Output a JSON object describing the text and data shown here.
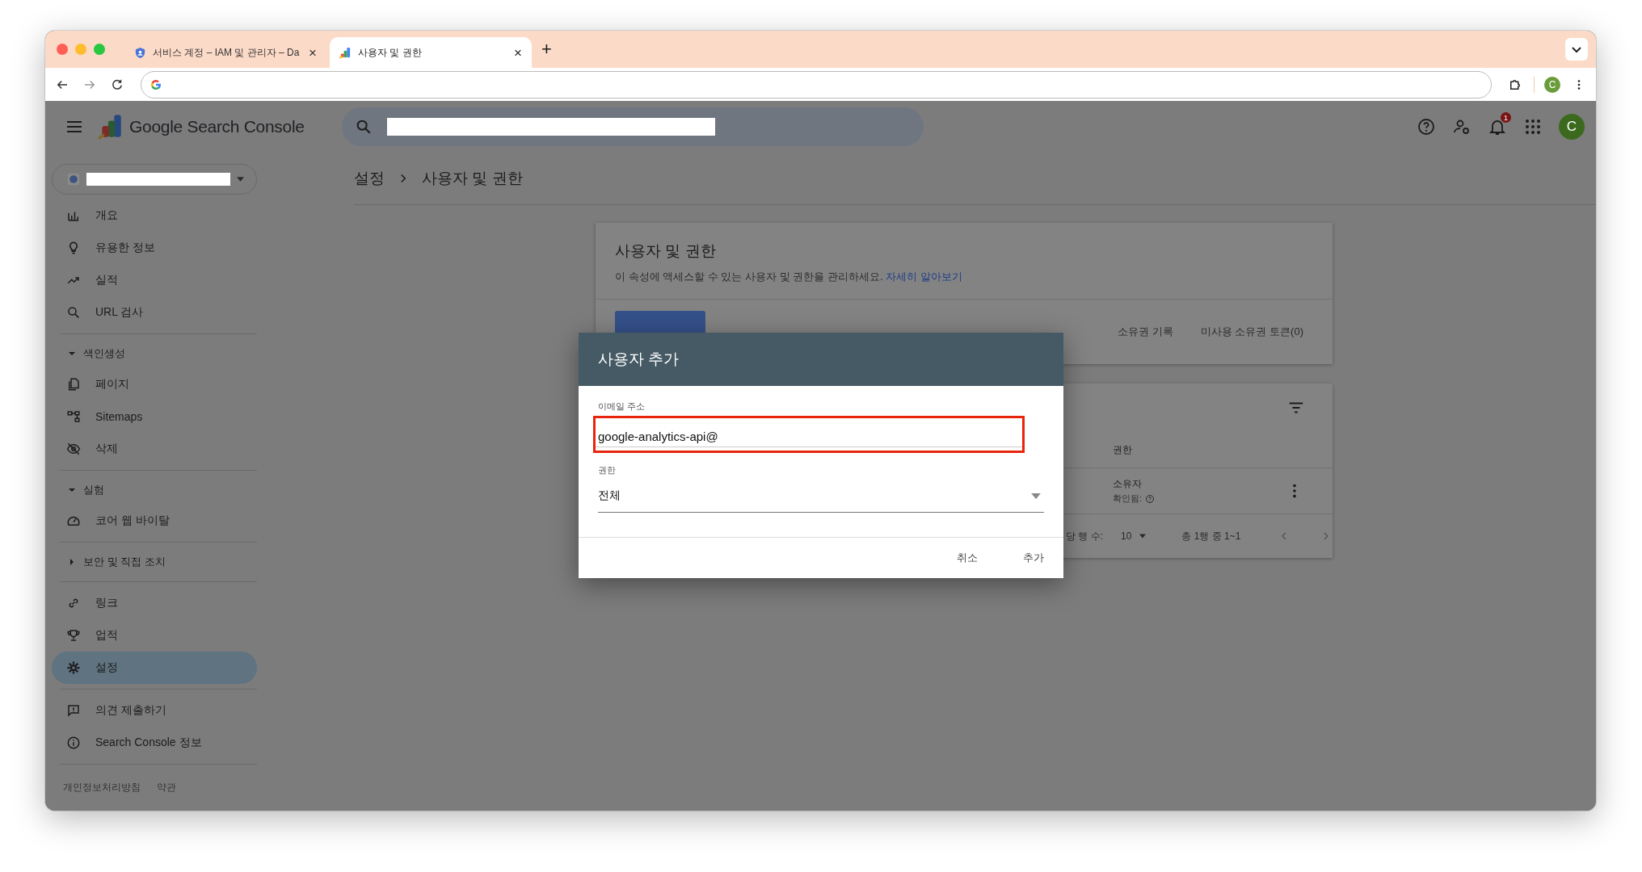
{
  "browser": {
    "tabs": [
      {
        "title": "서비스 계정 – IAM 및 관리자 – Da",
        "selected": false,
        "close": "×"
      },
      {
        "title": "사용자 및 권한",
        "selected": true,
        "close": "×"
      }
    ],
    "new_tab": "+",
    "profile_initial": "C"
  },
  "header": {
    "product": "Google Search Console",
    "notifications": "1",
    "avatar_initial": "C"
  },
  "sidebar": {
    "nav": [
      {
        "kind": "item",
        "label": "개요",
        "selected": false
      },
      {
        "kind": "item",
        "label": "유용한 정보",
        "selected": false
      },
      {
        "kind": "item",
        "label": "실적",
        "selected": false
      },
      {
        "kind": "item",
        "label": "URL 검사",
        "selected": false
      },
      {
        "kind": "divider"
      },
      {
        "kind": "section",
        "label": "색인생성",
        "expanded": true
      },
      {
        "kind": "item",
        "label": "페이지",
        "selected": false
      },
      {
        "kind": "item",
        "label": "Sitemaps",
        "selected": false
      },
      {
        "kind": "item",
        "label": "삭제",
        "selected": false
      },
      {
        "kind": "divider"
      },
      {
        "kind": "section",
        "label": "실험",
        "expanded": true
      },
      {
        "kind": "item",
        "label": "코어 웹 바이탈",
        "selected": false
      },
      {
        "kind": "divider"
      },
      {
        "kind": "section",
        "label": "보안 및 직접 조치",
        "expanded": false
      },
      {
        "kind": "divider"
      },
      {
        "kind": "item",
        "label": "링크",
        "selected": false
      },
      {
        "kind": "item",
        "label": "업적",
        "selected": false
      },
      {
        "kind": "item",
        "label": "설정",
        "selected": true
      },
      {
        "kind": "divider"
      },
      {
        "kind": "item",
        "label": "의견 제출하기",
        "selected": false
      },
      {
        "kind": "item",
        "label": "Search Console 정보",
        "selected": false
      },
      {
        "kind": "divider"
      }
    ],
    "footer_links": [
      "개인정보처리방침",
      "약관"
    ]
  },
  "breadcrumb": [
    "설정",
    "사용자 및 권한"
  ],
  "card": {
    "title": "사용자 및 권한",
    "description": "이 속성에 액세스할 수 있는 사용자 및 권한을 관리하세요.",
    "link": "자세히 알아보기",
    "actions": [
      "소유권 기록",
      "미사용 소유권 토큰(0)"
    ]
  },
  "table": {
    "columns": [
      "권한"
    ],
    "rows": [
      {
        "permission": "소유자",
        "status": "확인됨:"
      }
    ],
    "pagination": {
      "rows_label": "당 행 수:",
      "rows_per_page": "10",
      "range": "총 1행 중 1~1"
    }
  },
  "dialog": {
    "title": "사용자 추가",
    "email": {
      "label": "이메일 주소",
      "value": "google-analytics-api@",
      "highlighted": true
    },
    "permission": {
      "label": "권한",
      "value": "전체"
    },
    "buttons": [
      "취소",
      "추가"
    ]
  }
}
